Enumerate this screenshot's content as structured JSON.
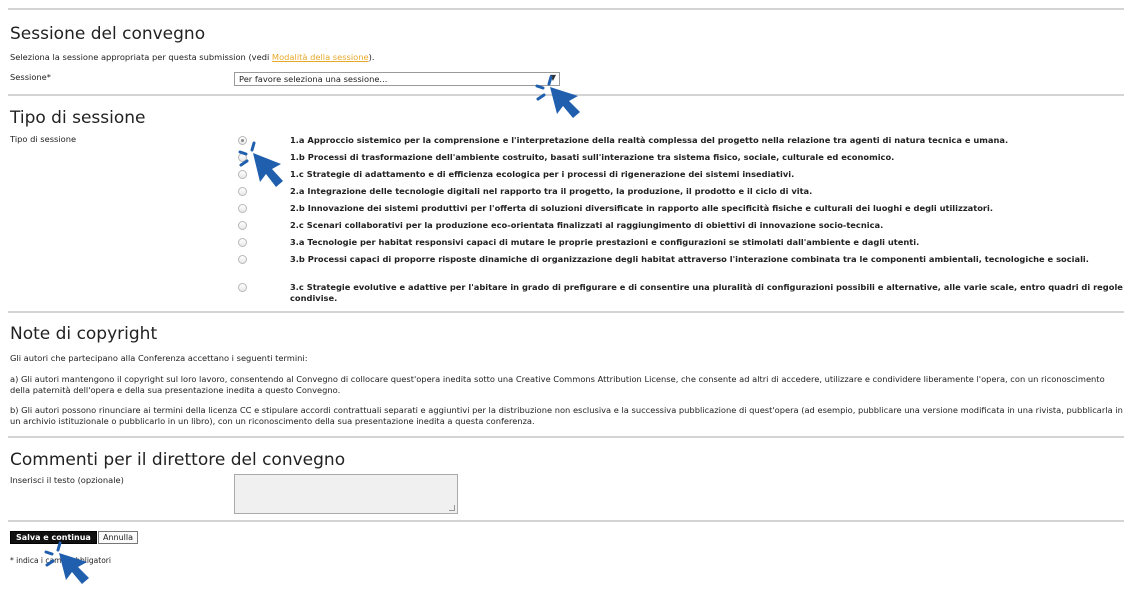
{
  "session": {
    "title": "Sessione del convegno",
    "instruction_prefix": "Seleziona la sessione appropriata per questa submission (vedi",
    "instruction_link": "Modalità della sessione",
    "instruction_suffix": ").",
    "field_label": "Sessione*",
    "select_value": "Per favore seleziona una sessione...",
    "select_arrow": "▼"
  },
  "session_type": {
    "title": "Tipo di sessione",
    "field_label": "Tipo di sessione",
    "options": [
      {
        "label": "1.a Approccio sistemico per la comprensione e l'interpretazione della realtà complessa del progetto nella relazione tra agenti di natura tecnica e umana.",
        "checked": true
      },
      {
        "label": "1.b Processi di trasformazione dell'ambiente costruito, basati sull'interazione tra sistema fisico, sociale, culturale ed economico.",
        "checked": false
      },
      {
        "label": "1.c Strategie di adattamento e di efficienza ecologica per i processi di rigenerazione dei sistemi insediativi.",
        "checked": false
      },
      {
        "label": "2.a Integrazione delle tecnologie digitali nel rapporto tra il progetto, la produzione, il prodotto e il ciclo di vita.",
        "checked": false
      },
      {
        "label": "2.b Innovazione dei sistemi produttivi per l'offerta di soluzioni diversificate in rapporto alle specificità fisiche e culturali dei luoghi e degli utilizzatori.",
        "checked": false
      },
      {
        "label": "2.c Scenari collaborativi per la produzione eco-orientata finalizzati al raggiungimento di obiettivi di innovazione socio-tecnica.",
        "checked": false
      },
      {
        "label": "3.a Tecnologie per habitat responsivi capaci di mutare le proprie prestazioni e configurazioni se stimolati dall'ambiente e dagli utenti.",
        "checked": false
      },
      {
        "label": "3.b Processi capaci di proporre risposte dinamiche di organizzazione degli habitat attraverso l'interazione combinata tra le componenti ambientali, tecnologiche e sociali.",
        "checked": false
      },
      {
        "label": "3.c Strategie evolutive e adattive per l'abitare in grado di prefigurare e di consentire una pluralità di configurazioni possibili e alternative, alle varie scale, entro quadri di regole condivise.",
        "checked": false
      }
    ]
  },
  "copyright": {
    "title": "Note di copyright",
    "intro": "Gli autori che partecipano alla Conferenza accettano i seguenti termini:",
    "term_a": "a) Gli autori mantengono il copyright sul loro lavoro, consentendo al Convegno di collocare quest'opera inedita sotto una Creative Commons Attribution License, che consente ad altri di accedere, utilizzare e condividere liberamente l'opera, con un riconoscimento della paternità dell'opera e della sua presentazione inedita a questo Convegno.",
    "term_b": "b) Gli autori possono rinunciare ai termini della licenza CC e stipulare accordi contrattuali separati e aggiuntivi per la distribuzione non esclusiva e la successiva pubblicazione di quest'opera (ad esempio, pubblicare una versione modificata in una rivista, pubblicarla in un archivio istituzionale o pubblicarlo in un libro), con un riconoscimento della sua presentazione inedita a questa conferenza."
  },
  "comments": {
    "title": "Commenti per il direttore del convegno",
    "field_label": "Inserisci il testo (opzionale)"
  },
  "actions": {
    "save_label": "Salva e continua",
    "cancel_label": "Annulla",
    "required_note": "* indica i campi obbligatori"
  },
  "colors": {
    "link": "#e8a92a",
    "cursor": "#1f5fae",
    "primary_button": "#111111"
  },
  "icons": [
    "cursor-arrow-icon",
    "dropdown-arrow-icon"
  ]
}
